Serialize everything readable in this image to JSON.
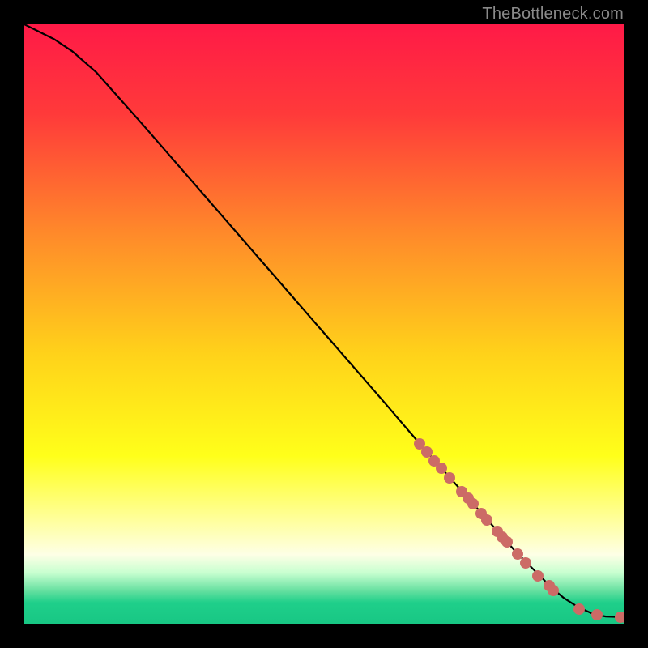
{
  "watermark": "TheBottleneck.com",
  "colors": {
    "frame": "#000000",
    "curve": "#000000",
    "dot": "#cc6b66",
    "gradient_stops": [
      {
        "pos": 0.0,
        "color": "#ff1a47"
      },
      {
        "pos": 0.15,
        "color": "#ff3a3a"
      },
      {
        "pos": 0.35,
        "color": "#ff8a2a"
      },
      {
        "pos": 0.55,
        "color": "#ffd21a"
      },
      {
        "pos": 0.72,
        "color": "#ffff1a"
      },
      {
        "pos": 0.83,
        "color": "#ffffa0"
      },
      {
        "pos": 0.885,
        "color": "#fdffe6"
      },
      {
        "pos": 0.915,
        "color": "#c8ffd0"
      },
      {
        "pos": 0.945,
        "color": "#66e0a0"
      },
      {
        "pos": 0.965,
        "color": "#1fcf8a"
      },
      {
        "pos": 1.0,
        "color": "#18c784"
      }
    ]
  },
  "chart_data": {
    "type": "line",
    "title": "",
    "xlabel": "",
    "ylabel": "",
    "xlim": [
      0,
      100
    ],
    "ylim": [
      0,
      100
    ],
    "grid": false,
    "series": [
      {
        "name": "curve",
        "x": [
          0,
          2,
          5,
          8,
          12,
          20,
          30,
          40,
          50,
          60,
          66,
          70,
          74,
          78,
          82,
          85,
          88,
          90,
          92.5,
          95,
          97,
          100
        ],
        "y": [
          100,
          99,
          97.5,
          95.5,
          92,
          83,
          71.5,
          60,
          48.5,
          37,
          30,
          25.5,
          21,
          16.5,
          12,
          9,
          6,
          4.3,
          2.7,
          1.6,
          1.2,
          1.1
        ]
      }
    ],
    "data_points": [
      {
        "x": 66,
        "y": 30
      },
      {
        "x": 67.2,
        "y": 28.6
      },
      {
        "x": 68.4,
        "y": 27.2
      },
      {
        "x": 69.6,
        "y": 25.9
      },
      {
        "x": 71.0,
        "y": 24.3
      },
      {
        "x": 73.0,
        "y": 22.0
      },
      {
        "x": 74.0,
        "y": 20.9
      },
      {
        "x": 74.8,
        "y": 20.0
      },
      {
        "x": 76.2,
        "y": 18.4
      },
      {
        "x": 77.2,
        "y": 17.3
      },
      {
        "x": 78.9,
        "y": 15.4
      },
      {
        "x": 79.7,
        "y": 14.5
      },
      {
        "x": 80.5,
        "y": 13.6
      },
      {
        "x": 82.3,
        "y": 11.6
      },
      {
        "x": 83.7,
        "y": 10.1
      },
      {
        "x": 85.7,
        "y": 8.0
      },
      {
        "x": 87.5,
        "y": 6.3
      },
      {
        "x": 88.2,
        "y": 5.6
      },
      {
        "x": 92.5,
        "y": 2.4
      },
      {
        "x": 95.5,
        "y": 1.5
      },
      {
        "x": 99.5,
        "y": 1.1
      },
      {
        "x": 100.3,
        "y": 1.1
      }
    ]
  }
}
